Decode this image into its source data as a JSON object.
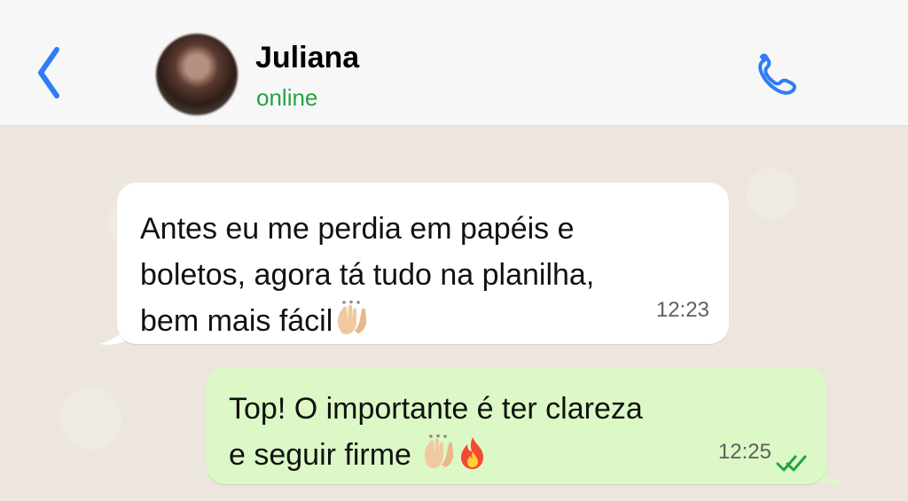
{
  "header": {
    "contact_name": "Juliana",
    "status": "online",
    "status_color": "#25a244",
    "accent": "#2f7cf6"
  },
  "messages": [
    {
      "direction": "incoming",
      "text": "Antes eu me perdia em papéis e\nboletos, agora tá tudo na planilha,\nbem mais fácil",
      "emoji": [
        "raising-hands"
      ],
      "time": "12:23"
    },
    {
      "direction": "outgoing",
      "text": "Top! O importante é ter clareza\ne seguir firme ",
      "emoji": [
        "raising-hands",
        "fire"
      ],
      "time": "12:25",
      "status_icon": "double-check-icon"
    }
  ],
  "icons": {
    "back": "chevron-left-icon",
    "call": "phone-icon"
  }
}
